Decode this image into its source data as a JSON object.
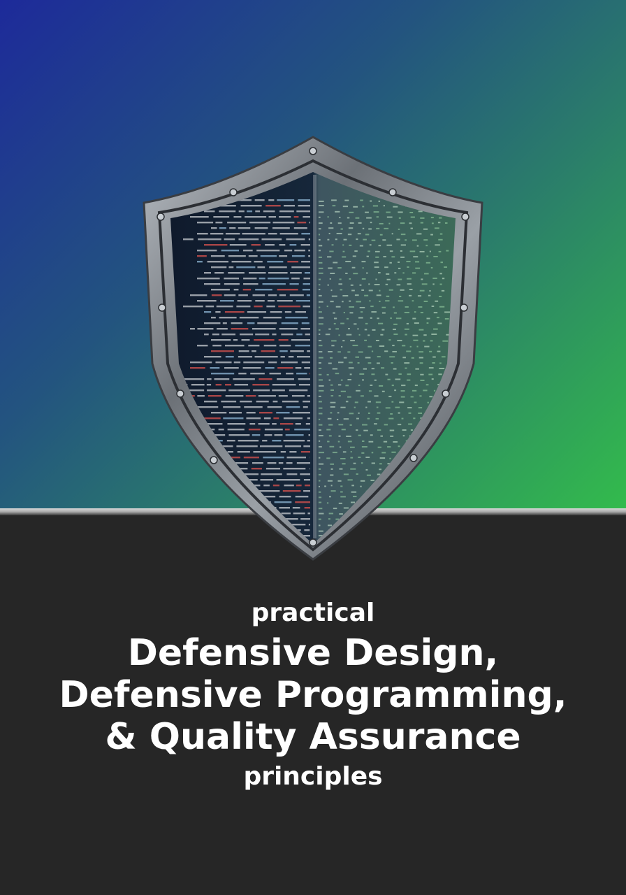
{
  "cover": {
    "title_top": "practical",
    "title_lines": [
      "Defensive Design,",
      "Defensive Programming,",
      "& Quality Assurance"
    ],
    "title_bottom": "principles"
  },
  "colors": {
    "background_dark": "#262626",
    "gradient_start": "#1d2a9a",
    "gradient_end": "#33bb4c",
    "text": "#ffffff",
    "shield_metal": "#8a8f96"
  },
  "icons": {
    "hero": "shield-icon",
    "hero_content": "code-listing-illustration"
  }
}
